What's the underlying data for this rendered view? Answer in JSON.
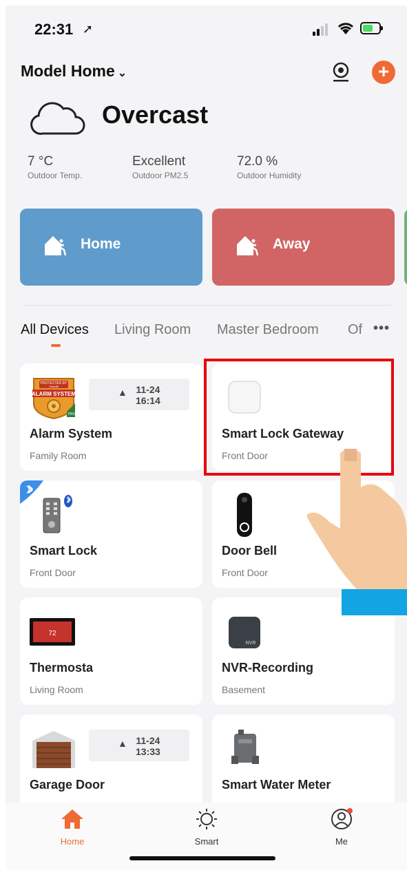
{
  "status": {
    "time": "22:31",
    "location_glyph": "➚"
  },
  "header": {
    "home_name": "Model Home",
    "chevron": "⌄",
    "add": "+"
  },
  "weather": {
    "condition": "Overcast"
  },
  "stats": [
    {
      "value": "7 °C",
      "label": "Outdoor Temp."
    },
    {
      "value": "Excellent",
      "label": "Outdoor PM2.5"
    },
    {
      "value": "72.0 %",
      "label": "Outdoor Humidity"
    }
  ],
  "scenes": [
    {
      "label": "Home",
      "color": "#5f9ccb"
    },
    {
      "label": "Away",
      "color": "#d16565"
    }
  ],
  "tabs": [
    {
      "label": "All Devices"
    },
    {
      "label": "Living Room"
    },
    {
      "label": "Master Bedroom"
    },
    {
      "label": "Of"
    }
  ],
  "more": "•••",
  "devices": [
    {
      "name": "Alarm System",
      "room": "Family Room",
      "chip_date": "11-24",
      "chip_time": "16:14",
      "icon": "alarm-system-badge"
    },
    {
      "name": "Smart Lock Gateway",
      "room": "Front Door",
      "icon": "gateway-icon"
    },
    {
      "name": "Smart Lock",
      "room": "Front Door",
      "icon": "smart-lock-icon"
    },
    {
      "name": "Door Bell",
      "room": "Front Door",
      "icon": "doorbell-icon"
    },
    {
      "name": "Thermosta",
      "room": "Living Room",
      "icon": "thermostat-icon"
    },
    {
      "name": "NVR-Recording",
      "room": "Basement",
      "icon": "nvr-icon"
    },
    {
      "name": "Garage Door",
      "room": "",
      "chip_date": "11-24",
      "chip_time": "13:33",
      "icon": "garage-icon"
    },
    {
      "name": "Smart Water Meter",
      "room": "",
      "icon": "water-meter-icon"
    }
  ],
  "badges": {
    "alarm_top": "PROTECTED BY",
    "alarm_brand": "Smartfit",
    "alarm_main": "ALARM SYSTEM",
    "alarm_pro": "PRO",
    "thermo_value": "72",
    "nvr": "NVR"
  },
  "nav": [
    {
      "label": "Home",
      "active": true
    },
    {
      "label": "Smart",
      "active": false
    },
    {
      "label": "Me",
      "active": false
    }
  ],
  "colors": {
    "accent": "#ef6a35",
    "highlight": "#e8000d"
  }
}
